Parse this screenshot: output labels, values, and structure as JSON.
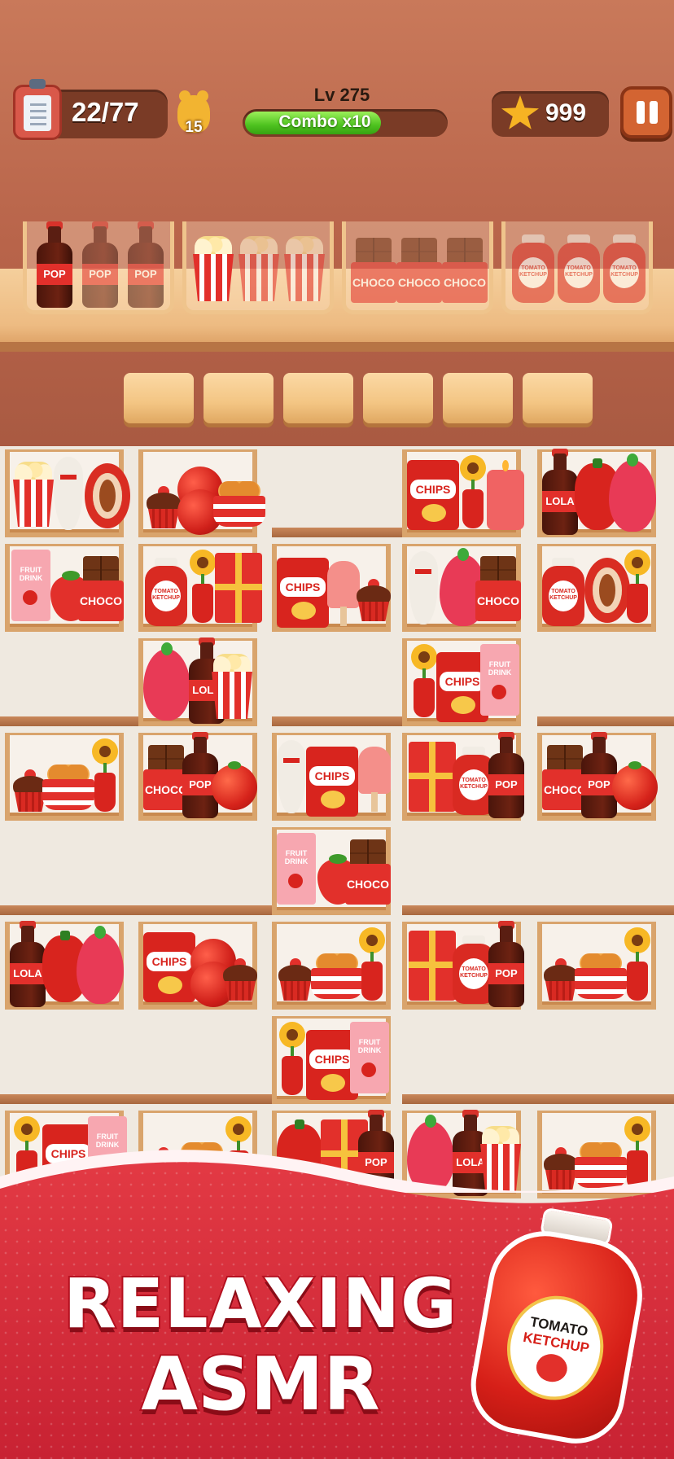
{
  "hud": {
    "orders_progress": "22/77",
    "bear_count": "15",
    "level": "Lv 275",
    "combo_label": "Combo x10",
    "combo_fill_fraction": 0.68,
    "stars": "999"
  },
  "goal_labels": {
    "pop": "POP",
    "choco": "CHOCO",
    "ketchup_line1": "TOMATO",
    "ketchup_line2": "KETCHUP"
  },
  "item_labels": {
    "chips": "CHIPS",
    "lola": "LOLA",
    "pop": "POP",
    "choco": "CHOCO",
    "fruit_drink_line1": "FRUIT",
    "fruit_drink_line2": "DRINK",
    "tomato_line1": "TOMATO",
    "tomato_line2": "KETCHUP"
  },
  "banner": {
    "line1": "RELAXING",
    "line2": "ASMR",
    "ketchup_line1": "TOMATO",
    "ketchup_line2": "KETCHUP"
  },
  "colors": {
    "accent_red": "#e2302b",
    "wood": "#b8644a",
    "combo_green": "#4ec21f",
    "star_gold": "#f6b323"
  },
  "icons": [
    "clipboard-icon",
    "bear-icon",
    "star-icon",
    "pause-icon"
  ]
}
